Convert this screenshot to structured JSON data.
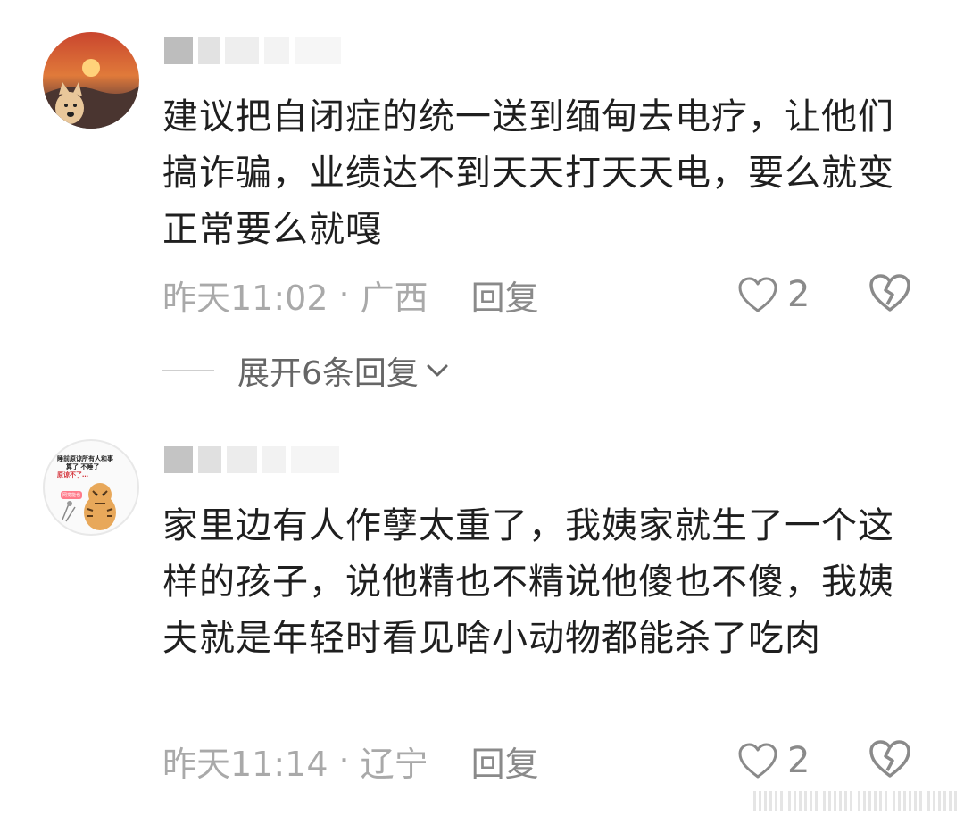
{
  "comments": [
    {
      "text": "建议把自闭症的统一送到缅甸去电疗，让他们搞诈骗，业绩达不到天天打天天电，要么就变正常要么就嘎",
      "time": "昨天11:02",
      "separator": "·",
      "location": "广西",
      "reply_label": "回复",
      "like_count": "2"
    },
    {
      "text": "家里边有人作孽太重了，我姨家就生了一个这样的孩子，说他精也不精说他傻也不傻，我姨夫就是年轻时看见啥小动物都能杀了吃肉",
      "time": "昨天11:14",
      "separator": "·",
      "location": "辽宁",
      "reply_label": "回复",
      "like_count": "2"
    }
  ],
  "expand_replies_label": "展开6条回复",
  "avatar2_text": {
    "line1": "睡前原谅所有人和事",
    "line2": "算了 不睡了",
    "line3": "原谅不了…",
    "badge": "网觉能也"
  },
  "colors": {
    "text": "#1f1f1f",
    "meta": "#a9a9a9",
    "icon": "#8a8a8a"
  }
}
